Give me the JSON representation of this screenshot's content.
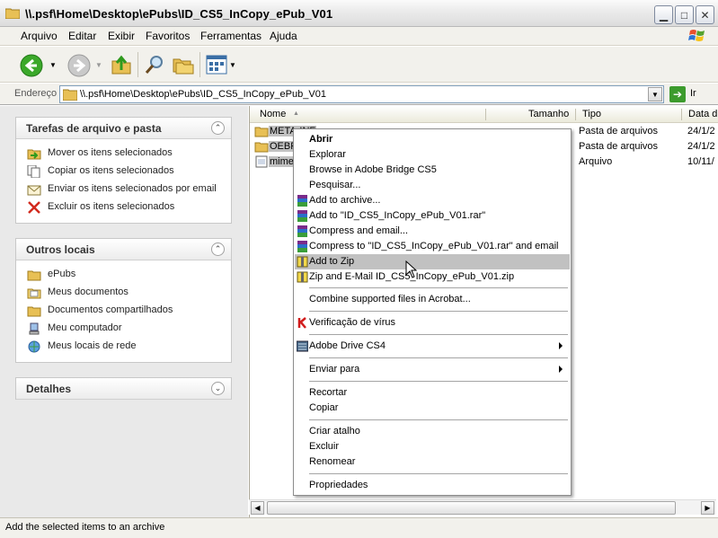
{
  "window": {
    "title": "\\\\.psf\\Home\\Desktop\\ePubs\\ID_CS5_InCopy_ePub_V01"
  },
  "menu": [
    "Arquivo",
    "Editar",
    "Exibir",
    "Favoritos",
    "Ferramentas",
    "Ajuda"
  ],
  "address": {
    "label": "Endereço",
    "path": "\\\\.psf\\Home\\Desktop\\ePubs\\ID_CS5_InCopy_ePub_V01",
    "go_label": "Ir"
  },
  "tasks_panel": {
    "title": "Tarefas de arquivo e pasta",
    "items": [
      "Mover os itens selecionados",
      "Copiar os itens selecionados",
      "Enviar os itens selecionados por email",
      "Excluir os itens selecionados"
    ]
  },
  "places_panel": {
    "title": "Outros locais",
    "items": [
      "ePubs",
      "Meus documentos",
      "Documentos compartilhados",
      "Meu computador",
      "Meus locais de rede"
    ]
  },
  "details_panel": {
    "title": "Detalhes"
  },
  "columns": [
    "Nome",
    "Tamanho",
    "Tipo",
    "Data d"
  ],
  "files": [
    {
      "name": "META-INF",
      "type": "Pasta de arquivos",
      "date": "24/1/2"
    },
    {
      "name": "OEBP",
      "type": "Pasta de arquivos",
      "date": "24/1/2"
    },
    {
      "name": "mimel",
      "type": "Arquivo",
      "date": "10/11/"
    }
  ],
  "context_menu": {
    "items": [
      "Abrir",
      "Explorar",
      "Browse in Adobe Bridge CS5",
      "Pesquisar...",
      "Add to archive...",
      "Add to \"ID_CS5_InCopy_ePub_V01.rar\"",
      "Compress and email...",
      "Compress to \"ID_CS5_InCopy_ePub_V01.rar\" and email",
      "Add to Zip",
      "Zip and E-Mail ID_CS5_InCopy_ePub_V01.zip",
      "Combine supported files in Acrobat...",
      "Verificação de vírus",
      "Adobe Drive CS4",
      "Enviar para",
      "Recortar",
      "Copiar",
      "Criar atalho",
      "Excluir",
      "Renomear",
      "Propriedades"
    ],
    "highlighted": "Add to Zip"
  },
  "status": {
    "text": "Add the selected items to an archive"
  }
}
